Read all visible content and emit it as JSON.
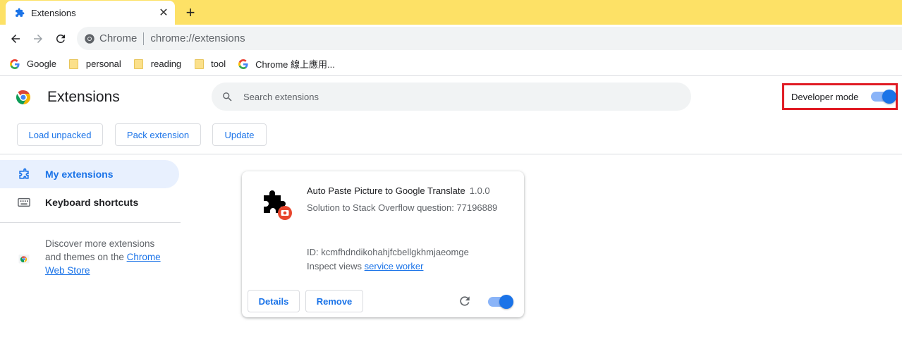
{
  "tab": {
    "title": "Extensions",
    "icon": "puzzle-icon",
    "close": "✕",
    "new_tab": "+"
  },
  "toolbar": {
    "site": "Chrome",
    "url": "chrome://extensions"
  },
  "bookmarks": [
    {
      "label": "Google",
      "icon": "google-icon"
    },
    {
      "label": "personal",
      "icon": "folder-icon"
    },
    {
      "label": "reading",
      "icon": "folder-icon"
    },
    {
      "label": "tool",
      "icon": "folder-icon"
    },
    {
      "label": "Chrome 線上應用...",
      "icon": "google-icon"
    }
  ],
  "header": {
    "title": "Extensions",
    "search_placeholder": "Search extensions",
    "developer_mode_label": "Developer mode",
    "developer_mode_on": true,
    "buttons": {
      "load_unpacked": "Load unpacked",
      "pack_extension": "Pack extension",
      "update": "Update"
    }
  },
  "sidebar": {
    "items": [
      {
        "label": "My extensions",
        "active": true
      },
      {
        "label": "Keyboard shortcuts",
        "active": false
      }
    ],
    "discover_text": "Discover more extensions and themes on the ",
    "discover_link": "Chrome Web Store"
  },
  "extension": {
    "name": "Auto Paste Picture to Google Translate",
    "version": "1.0.0",
    "description": "Solution to Stack Overflow question: 77196889",
    "id_label": "ID: ",
    "id": "kcmfhdndikohahjfcbellgkhmjaeomge",
    "inspect_label": "Inspect views ",
    "inspect_link": "service worker",
    "details_label": "Details",
    "remove_label": "Remove",
    "enabled": true
  },
  "colors": {
    "tabstrip": "#fde166",
    "accent": "#1a73e8",
    "highlight_border": "#e01b24"
  }
}
